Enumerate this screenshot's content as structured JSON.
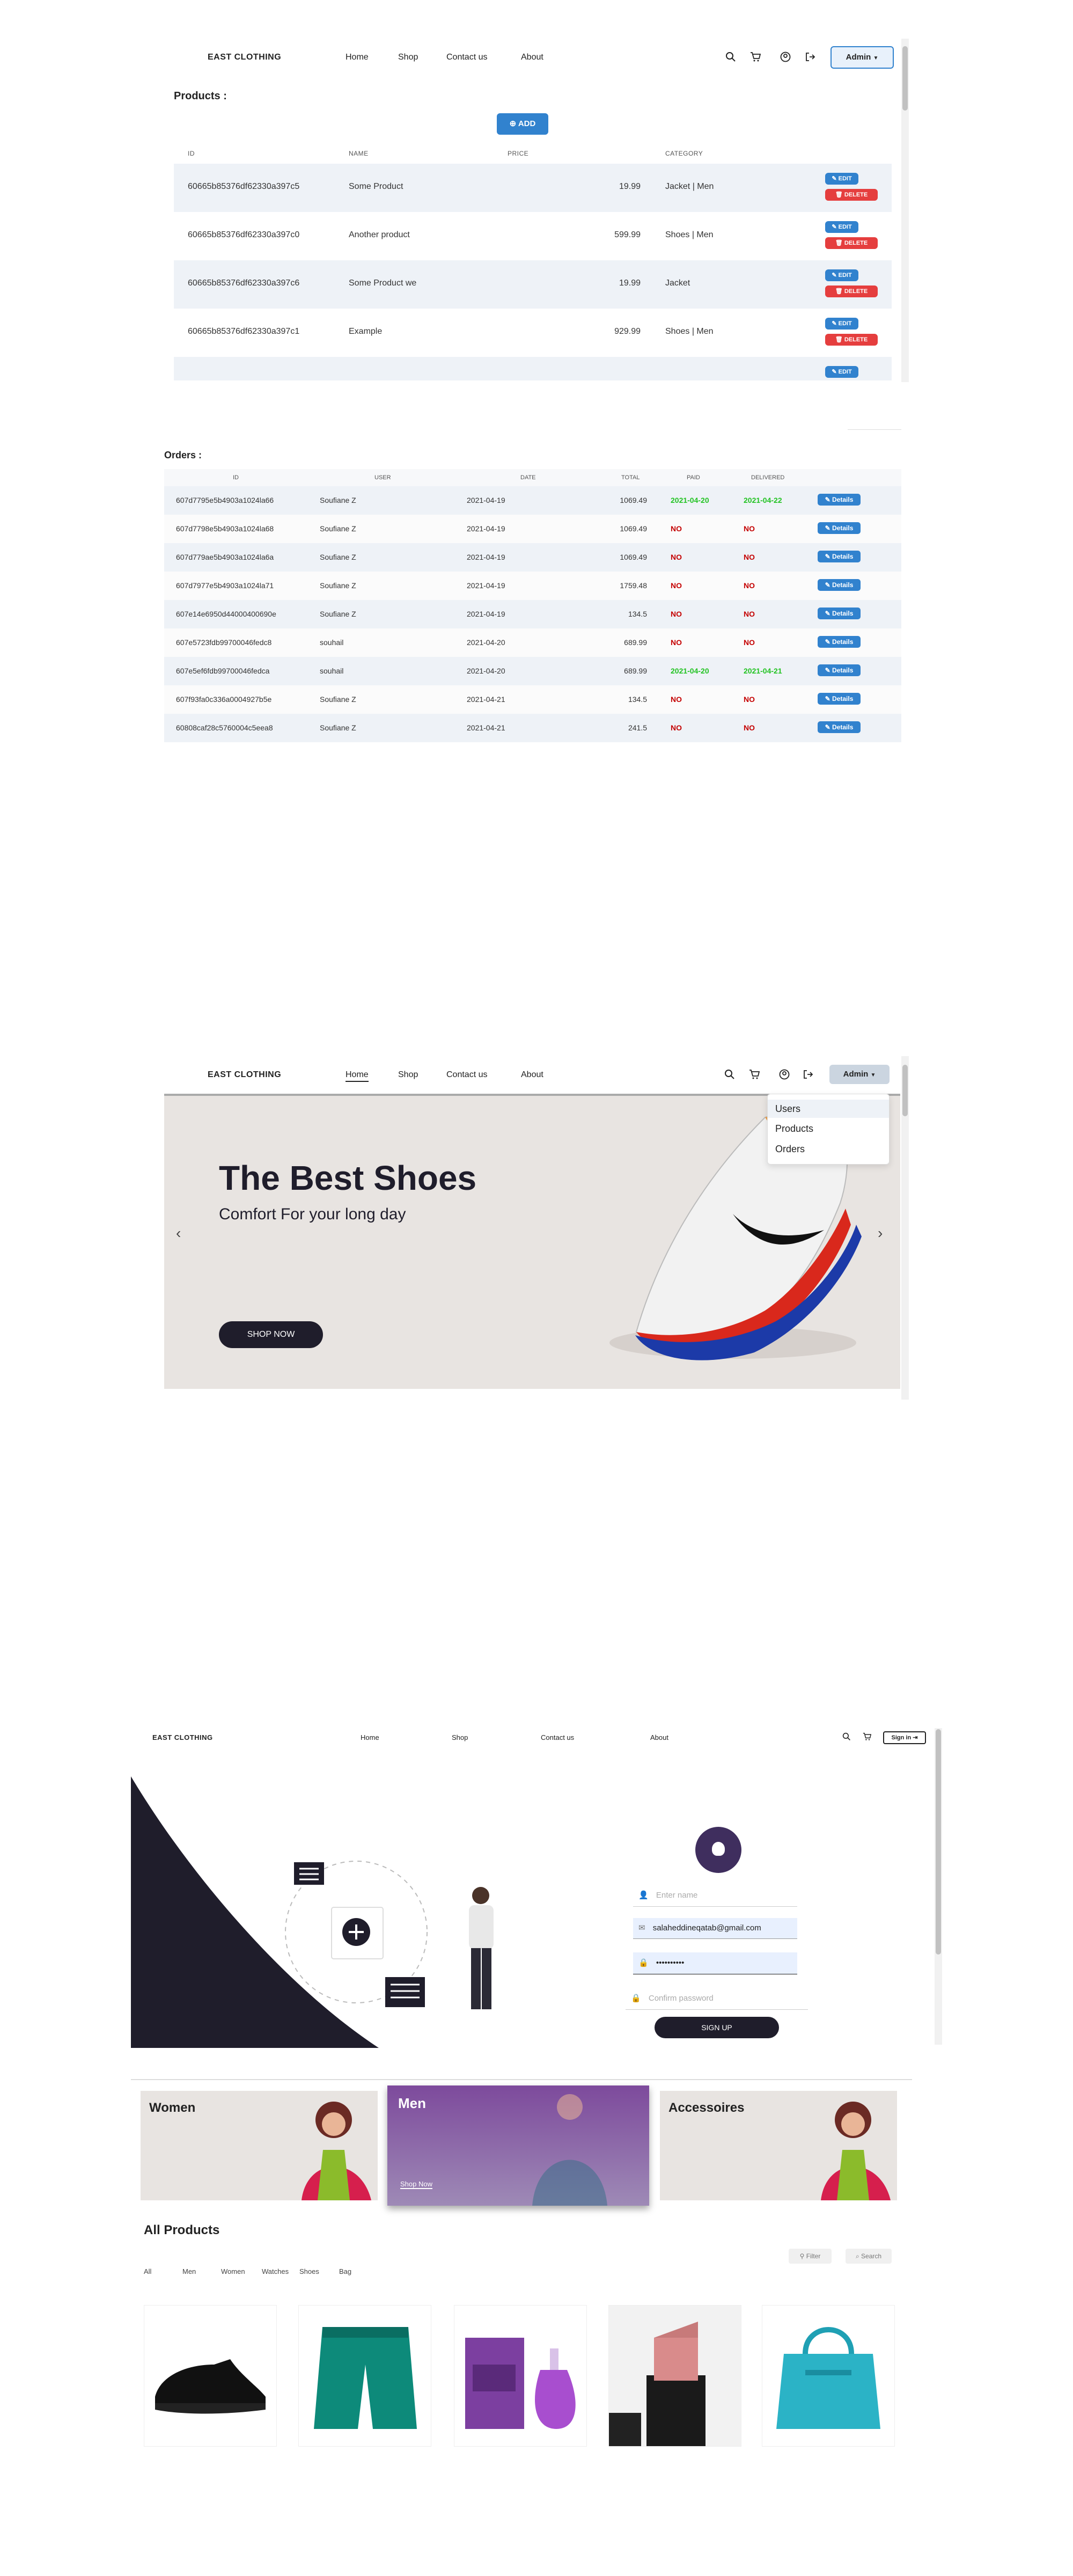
{
  "admin_products": {
    "brand": "EAST CLOTHING",
    "nav": [
      "Home",
      "Shop",
      "Contact us",
      "About"
    ],
    "admin_button": "Admin",
    "section_title": "Products :",
    "add_button": "ADD",
    "columns": [
      "ID",
      "NAME",
      "PRICE",
      "CATEGORY"
    ],
    "edit_label": "EDIT",
    "delete_label": "DELETE",
    "rows": [
      {
        "id": "60665b85376df62330a397c5",
        "name": "Some Product",
        "price": "19.99",
        "category": "Jacket | Men"
      },
      {
        "id": "60665b85376df62330a397c0",
        "name": "Another product",
        "price": "599.99",
        "category": "Shoes | Men"
      },
      {
        "id": "60665b85376df62330a397c6",
        "name": "Some Product we",
        "price": "19.99",
        "category": "Jacket"
      },
      {
        "id": "60665b85376df62330a397c1",
        "name": "Example",
        "price": "929.99",
        "category": "Shoes | Men"
      }
    ]
  },
  "admin_orders": {
    "section_title": "Orders :",
    "columns": [
      "ID",
      "USER",
      "DATE",
      "TOTAL",
      "PAID",
      "DELIVERED"
    ],
    "details_label": "Details",
    "rows": [
      {
        "id": "607d7795e5b4903a1024la66",
        "user": "Soufiane Z",
        "date": "2021-04-19",
        "total": "1069.49",
        "paid": "2021-04-20",
        "delivered": "2021-04-22"
      },
      {
        "id": "607d7798e5b4903a1024la68",
        "user": "Soufiane Z",
        "date": "2021-04-19",
        "total": "1069.49",
        "paid": "NO",
        "delivered": "NO"
      },
      {
        "id": "607d779ae5b4903a1024la6a",
        "user": "Soufiane Z",
        "date": "2021-04-19",
        "total": "1069.49",
        "paid": "NO",
        "delivered": "NO"
      },
      {
        "id": "607d7977e5b4903a1024la71",
        "user": "Soufiane Z",
        "date": "2021-04-19",
        "total": "1759.48",
        "paid": "NO",
        "delivered": "NO"
      },
      {
        "id": "607e14e6950d44000400690e",
        "user": "Soufiane Z",
        "date": "2021-04-19",
        "total": "134.5",
        "paid": "NO",
        "delivered": "NO"
      },
      {
        "id": "607e5723fdb99700046fedc8",
        "user": "souhail",
        "date": "2021-04-20",
        "total": "689.99",
        "paid": "NO",
        "delivered": "NO"
      },
      {
        "id": "607e5ef6fdb99700046fedca",
        "user": "souhail",
        "date": "2021-04-20",
        "total": "689.99",
        "paid": "2021-04-20",
        "delivered": "2021-04-21"
      },
      {
        "id": "607f93fa0c336a0004927b5e",
        "user": "Soufiane Z",
        "date": "2021-04-21",
        "total": "134.5",
        "paid": "NO",
        "delivered": "NO"
      },
      {
        "id": "60808caf28c5760004c5eea8",
        "user": "Soufiane Z",
        "date": "2021-04-21",
        "total": "241.5",
        "paid": "NO",
        "delivered": "NO"
      }
    ]
  },
  "home_admin": {
    "brand": "EAST CLOTHING",
    "nav": [
      "Home",
      "Shop",
      "Contact us",
      "About"
    ],
    "admin_button": "Admin",
    "dropdown": [
      "Users",
      "Products",
      "Orders"
    ],
    "hero_title": "The Best Shoes",
    "hero_subtitle": "Comfort For your long day",
    "hero_button": "SHOP NOW"
  },
  "signup_page": {
    "brand": "EAST CLOTHING",
    "nav": [
      "Home",
      "Shop",
      "Contact us",
      "About"
    ],
    "sign_in": "Sign in",
    "name_placeholder": "Enter name",
    "email_value": "salaheddineqatab@gmail.com",
    "password_value": "••••••••••",
    "confirm_placeholder": "Confirm password",
    "submit": "SIGN UP",
    "categories": [
      "Women",
      "Men",
      "Accessoires"
    ],
    "men_cta": "Shop Now",
    "all_products_title": "All Products",
    "filter_tabs": [
      "All",
      "Men",
      "Women",
      "Watches",
      "Shoes",
      "Bag"
    ],
    "filter_button": "Filter",
    "search_button": "Search"
  },
  "colors": {
    "primary": "#3182ce",
    "danger": "#e53e3e",
    "dark": "#1f1d2b",
    "row_alt": "#eef2f7"
  }
}
